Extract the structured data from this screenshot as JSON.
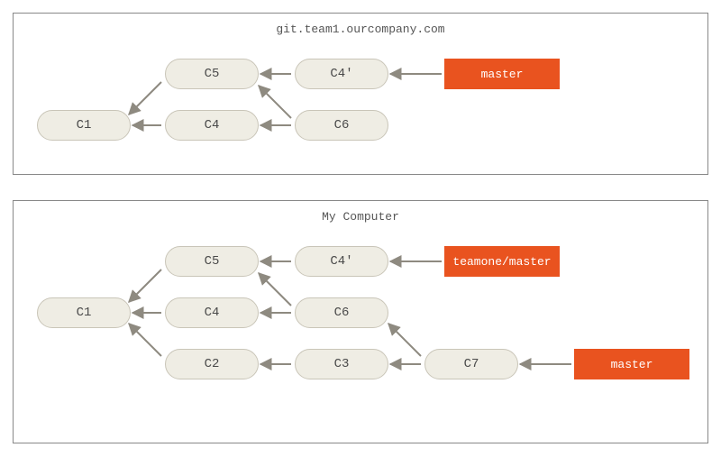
{
  "panels": {
    "remote": {
      "title": "git.team1.ourcompany.com",
      "commits": {
        "c1": "C1",
        "c4": "C4",
        "c5": "C5",
        "c6": "C6",
        "c4p": "C4'"
      },
      "refs": {
        "master": "master"
      }
    },
    "local": {
      "title": "My Computer",
      "commits": {
        "c1": "C1",
        "c2": "C2",
        "c3": "C3",
        "c4": "C4",
        "c5": "C5",
        "c6": "C6",
        "c4p": "C4'",
        "c7": "C7"
      },
      "refs": {
        "teamone_master": "teamone/master",
        "master": "master"
      }
    }
  },
  "chart_data": [
    {
      "type": "dag",
      "title": "git.team1.ourcompany.com",
      "nodes": [
        "C1",
        "C4",
        "C5",
        "C6",
        "C4'"
      ],
      "edges": [
        [
          "C5",
          "C1"
        ],
        [
          "C4",
          "C1"
        ],
        [
          "C4'",
          "C5"
        ],
        [
          "C6",
          "C5"
        ],
        [
          "C6",
          "C4"
        ]
      ],
      "refs": {
        "master": "C4'"
      }
    },
    {
      "type": "dag",
      "title": "My Computer",
      "nodes": [
        "C1",
        "C2",
        "C3",
        "C4",
        "C5",
        "C6",
        "C4'",
        "C7"
      ],
      "edges": [
        [
          "C5",
          "C1"
        ],
        [
          "C4",
          "C1"
        ],
        [
          "C2",
          "C1"
        ],
        [
          "C4'",
          "C5"
        ],
        [
          "C6",
          "C5"
        ],
        [
          "C6",
          "C4"
        ],
        [
          "C3",
          "C2"
        ],
        [
          "C7",
          "C6"
        ],
        [
          "C7",
          "C3"
        ]
      ],
      "refs": {
        "teamone/master": "C4'",
        "master": "C7"
      }
    }
  ]
}
